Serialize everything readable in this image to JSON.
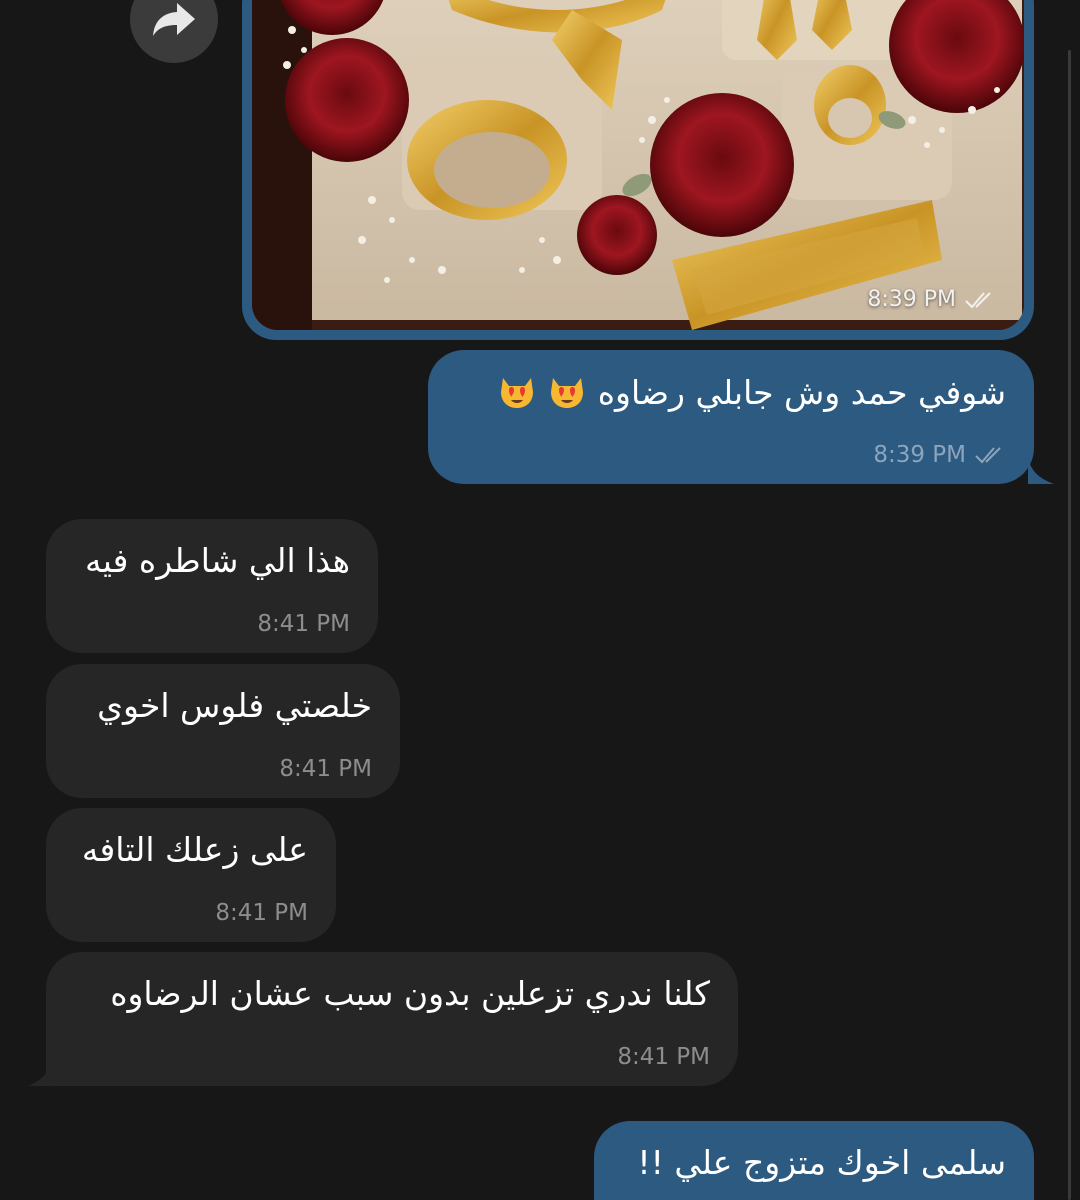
{
  "forward_icon": "forward-arrow-icon",
  "colors": {
    "background": "#171717",
    "outgoing_bubble": "#2d5a80",
    "incoming_bubble": "#262626",
    "outgoing_meta": "#8aa5bd",
    "incoming_meta": "#8d8d8d"
  },
  "photo_message": {
    "time": "8:39 PM",
    "status_icon": "double-check-icon"
  },
  "messages": [
    {
      "direction": "outgoing",
      "text": "شوفي حمد وش جابلي رضاوه",
      "emojis": [
        "heart-eyes-cat-emoji",
        "heart-eyes-cat-emoji"
      ],
      "time": "8:39 PM",
      "status_icon": "double-check-icon"
    },
    {
      "direction": "incoming",
      "text": "هذا الي شاطره فيه",
      "time": "8:41 PM"
    },
    {
      "direction": "incoming",
      "text": "خلصتي فلوس اخوي",
      "time": "8:41 PM"
    },
    {
      "direction": "incoming",
      "text": "على زعلك التافه",
      "time": "8:41 PM"
    },
    {
      "direction": "incoming",
      "text": "كلنا ندري تزعلين بدون سبب عشان الرضاوه",
      "time": "8:41 PM"
    },
    {
      "direction": "outgoing",
      "text": "سلمى اخوك متزوج علي !!",
      "time": ""
    }
  ]
}
